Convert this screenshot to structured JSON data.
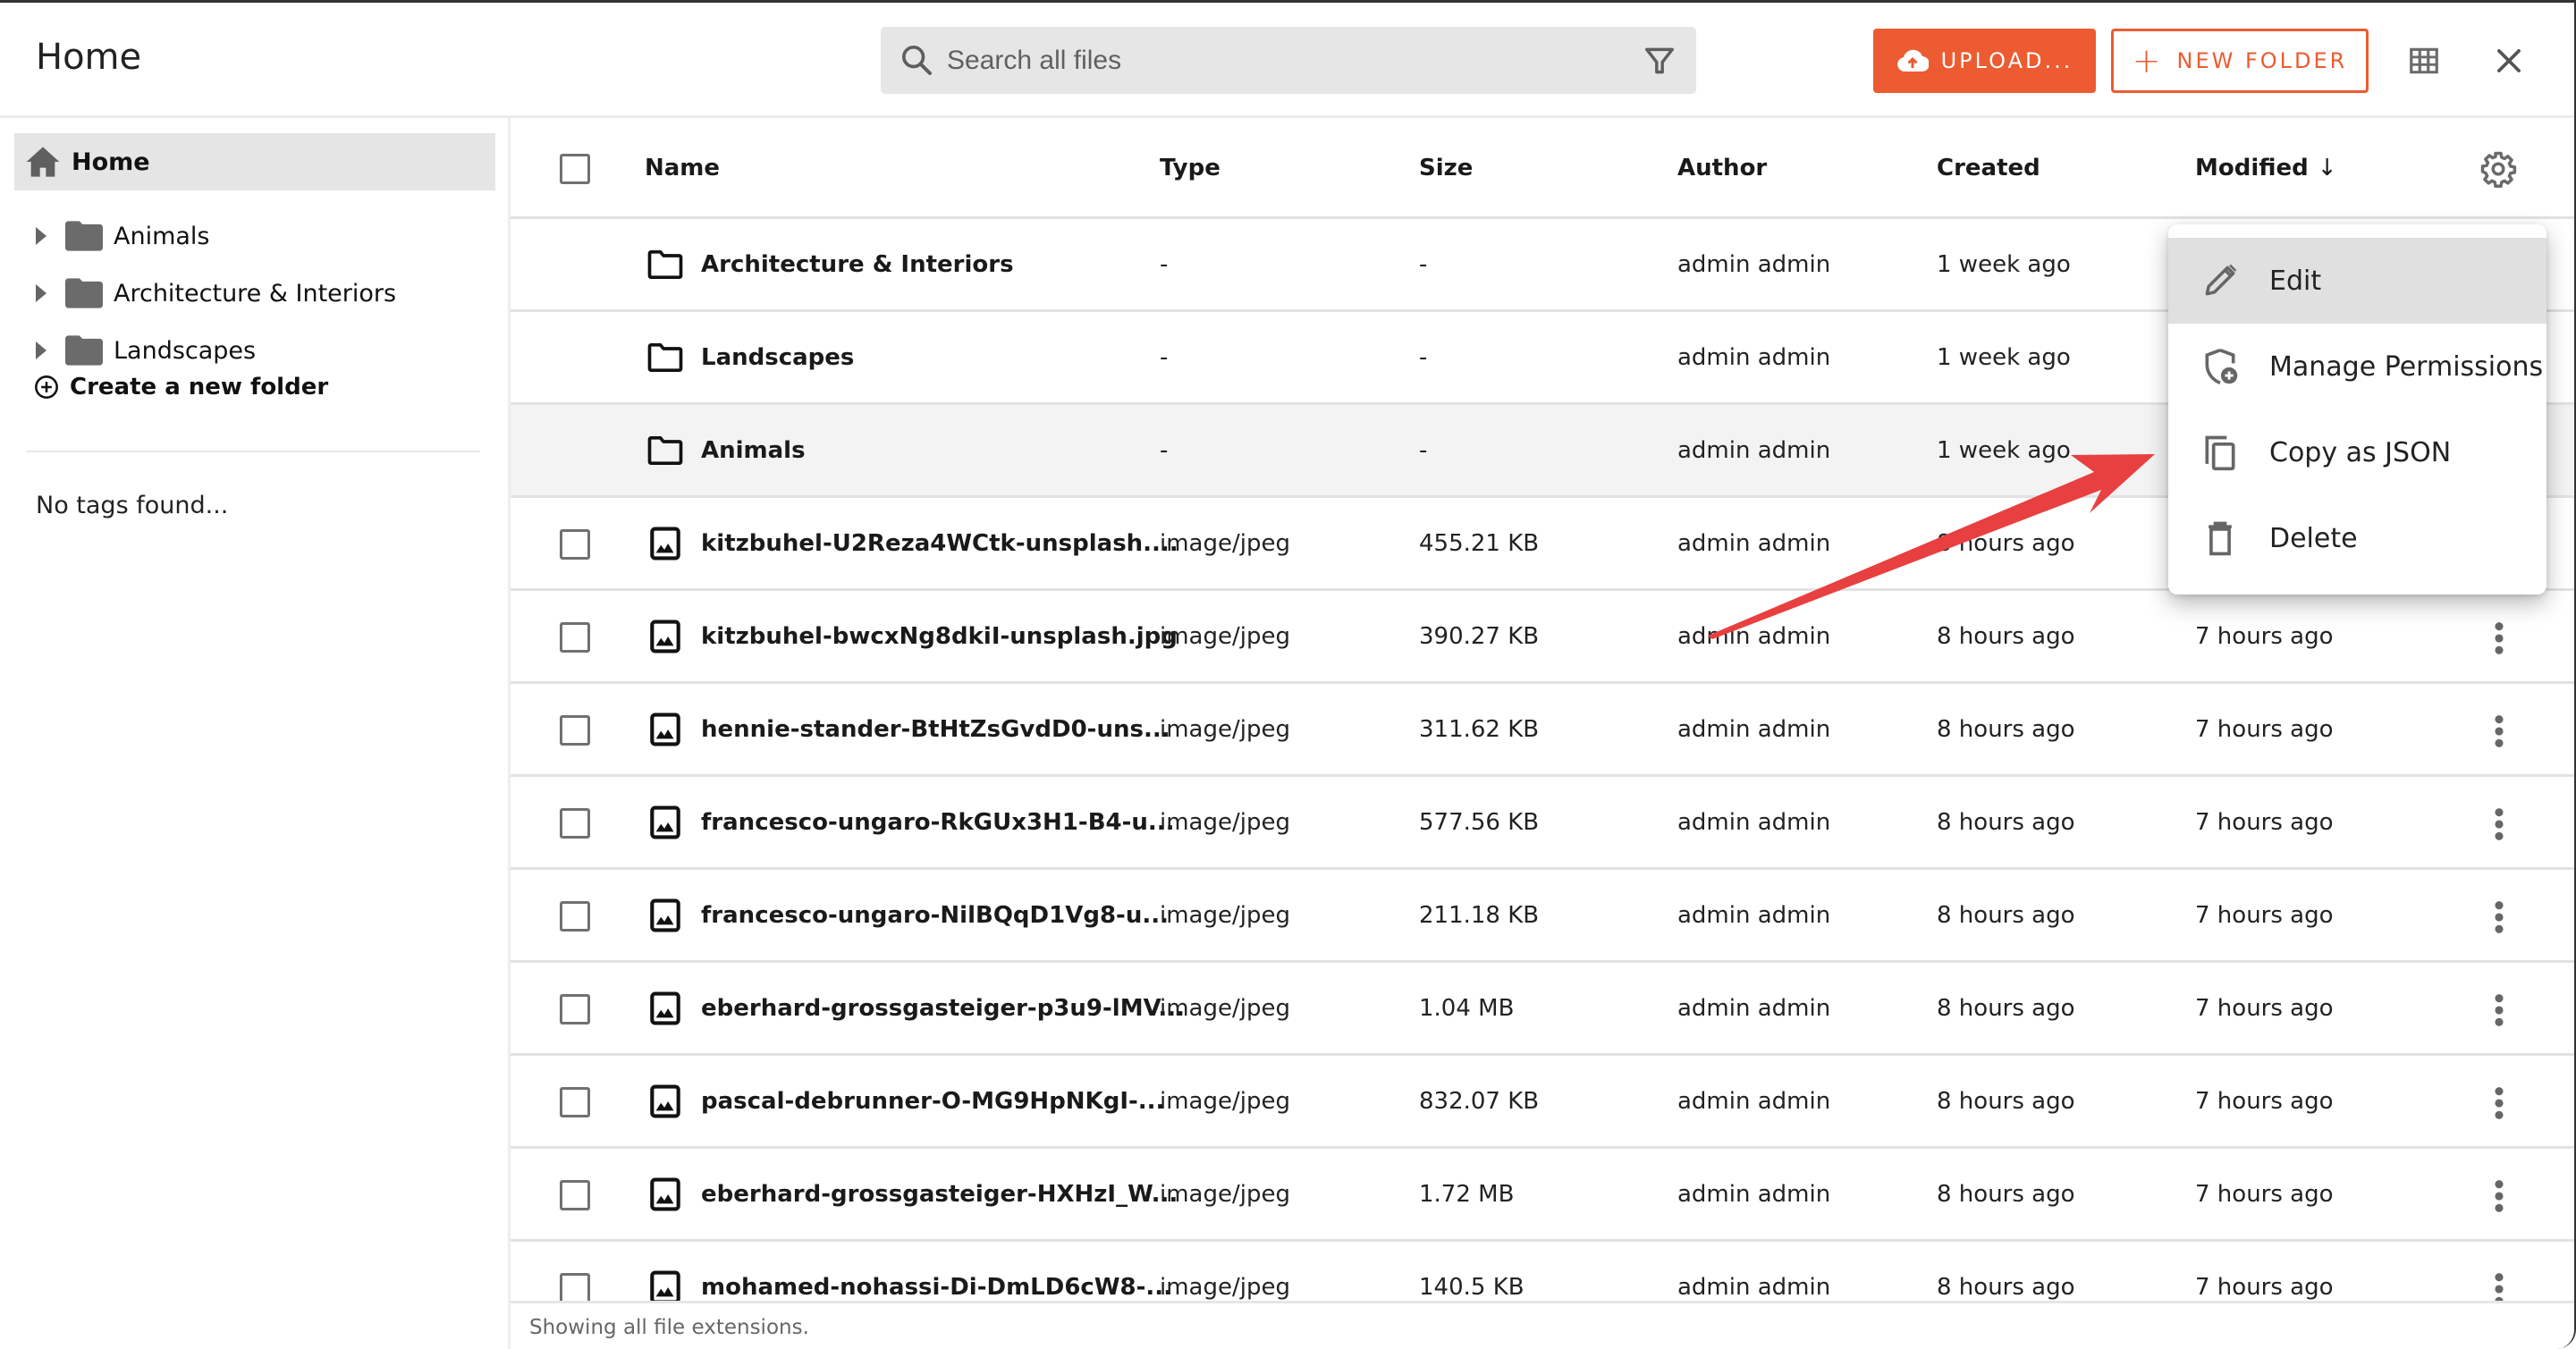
{
  "header": {
    "title": "Home",
    "search_placeholder": "Search all files",
    "upload_label": "UPLOAD...",
    "new_folder_label": "NEW FOLDER",
    "accent_color": "#ec5b31"
  },
  "sidebar": {
    "home_label": "Home",
    "folders": [
      {
        "label": "Animals"
      },
      {
        "label": "Architecture & Interiors"
      },
      {
        "label": "Landscapes"
      }
    ],
    "create_folder_label": "Create a new folder",
    "tags_text": "No tags found..."
  },
  "table": {
    "columns": {
      "name": "Name",
      "type": "Type",
      "size": "Size",
      "author": "Author",
      "created": "Created",
      "modified": "Modified"
    },
    "sort_indicator": "↓",
    "rows": [
      {
        "kind": "folder",
        "name": "Architecture & Interiors",
        "type": "-",
        "size": "-",
        "author": "admin admin",
        "created": "1 week ago",
        "modified": ""
      },
      {
        "kind": "folder",
        "name": "Landscapes",
        "type": "-",
        "size": "-",
        "author": "admin admin",
        "created": "1 week ago",
        "modified": ""
      },
      {
        "kind": "folder",
        "name": "Animals",
        "type": "-",
        "size": "-",
        "author": "admin admin",
        "created": "1 week ago",
        "modified": ""
      },
      {
        "kind": "file",
        "name": "kitzbuhel-U2Reza4WCtk-unsplash....",
        "type": "image/jpeg",
        "size": "455.21 KB",
        "author": "admin admin",
        "created": "8 hours ago",
        "modified": ""
      },
      {
        "kind": "file",
        "name": "kitzbuhel-bwcxNg8dkiI-unsplash.jpg",
        "type": "image/jpeg",
        "size": "390.27 KB",
        "author": "admin admin",
        "created": "8 hours ago",
        "modified": "7 hours ago"
      },
      {
        "kind": "file",
        "name": "hennie-stander-BtHtZsGvdD0-uns...",
        "type": "image/jpeg",
        "size": "311.62 KB",
        "author": "admin admin",
        "created": "8 hours ago",
        "modified": "7 hours ago"
      },
      {
        "kind": "file",
        "name": "francesco-ungaro-RkGUx3H1-B4-u...",
        "type": "image/jpeg",
        "size": "577.56 KB",
        "author": "admin admin",
        "created": "8 hours ago",
        "modified": "7 hours ago"
      },
      {
        "kind": "file",
        "name": "francesco-ungaro-NilBQqD1Vg8-u...",
        "type": "image/jpeg",
        "size": "211.18 KB",
        "author": "admin admin",
        "created": "8 hours ago",
        "modified": "7 hours ago"
      },
      {
        "kind": "file",
        "name": "eberhard-grossgasteiger-p3u9-lMV...",
        "type": "image/jpeg",
        "size": "1.04 MB",
        "author": "admin admin",
        "created": "8 hours ago",
        "modified": "7 hours ago"
      },
      {
        "kind": "file",
        "name": "pascal-debrunner-O-MG9HpNKgI-...",
        "type": "image/jpeg",
        "size": "832.07 KB",
        "author": "admin admin",
        "created": "8 hours ago",
        "modified": "7 hours ago"
      },
      {
        "kind": "file",
        "name": "eberhard-grossgasteiger-HXHzI_W...",
        "type": "image/jpeg",
        "size": "1.72 MB",
        "author": "admin admin",
        "created": "8 hours ago",
        "modified": "7 hours ago"
      },
      {
        "kind": "file",
        "name": "mohamed-nohassi-Di-DmLD6cW8-...",
        "type": "image/jpeg",
        "size": "140.5 KB",
        "author": "admin admin",
        "created": "8 hours ago",
        "modified": "7 hours ago"
      }
    ],
    "hover_row_index": 2
  },
  "footer": {
    "text": "Showing all file extensions."
  },
  "context_menu": {
    "items": [
      {
        "label": "Edit",
        "icon": "pencil-icon"
      },
      {
        "label": "Manage Permissions",
        "icon": "shield-plus-icon"
      },
      {
        "label": "Copy as JSON",
        "icon": "copy-icon"
      },
      {
        "label": "Delete",
        "icon": "trash-icon"
      }
    ],
    "active_index": 0
  },
  "annotation": {
    "arrow_color": "#e84040"
  }
}
